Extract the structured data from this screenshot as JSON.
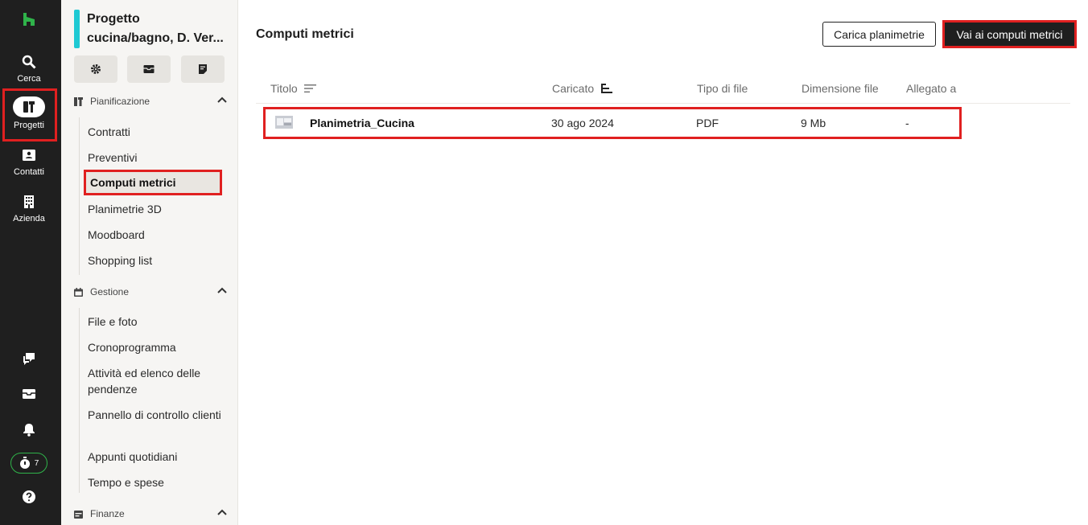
{
  "rail": {
    "items": [
      {
        "label": "Cerca",
        "icon": "search-icon"
      },
      {
        "label": "Progetti",
        "icon": "projects-icon"
      },
      {
        "label": "Contatti",
        "icon": "contact-card-icon"
      },
      {
        "label": "Azienda",
        "icon": "building-icon"
      }
    ],
    "timer_count": "7"
  },
  "sidebar": {
    "project_title_line1": "Progetto",
    "project_title_line2": "cucina/bagno, D. Ver...",
    "sections": [
      {
        "title": "Pianificazione",
        "items": [
          "Contratti",
          "Preventivi",
          "Computi metrici",
          "Planimetrie 3D",
          "Moodboard",
          "Shopping list"
        ]
      },
      {
        "title": "Gestione",
        "items": [
          "File e foto",
          "Cronoprogramma",
          "Attività ed elenco delle pendenze",
          "Pannello di controllo clienti",
          "Appunti quotidiani",
          "Tempo e spese"
        ]
      },
      {
        "title": "Finanze",
        "items": []
      }
    ]
  },
  "main": {
    "title": "Computi metrici",
    "upload_button": "Carica planimetrie",
    "goto_button": "Vai ai computi metrici",
    "columns": [
      "Titolo",
      "Caricato",
      "Tipo di file",
      "Dimensione file",
      "Allegato a"
    ],
    "rows": [
      {
        "title": "Planimetria_Cucina",
        "uploaded": "30 ago 2024",
        "type": "PDF",
        "size": "9 Mb",
        "attached": "-"
      }
    ]
  },
  "colors": {
    "accent": "#1ec9d3",
    "brand": "#2fb34a",
    "highlight": "#e02020"
  }
}
